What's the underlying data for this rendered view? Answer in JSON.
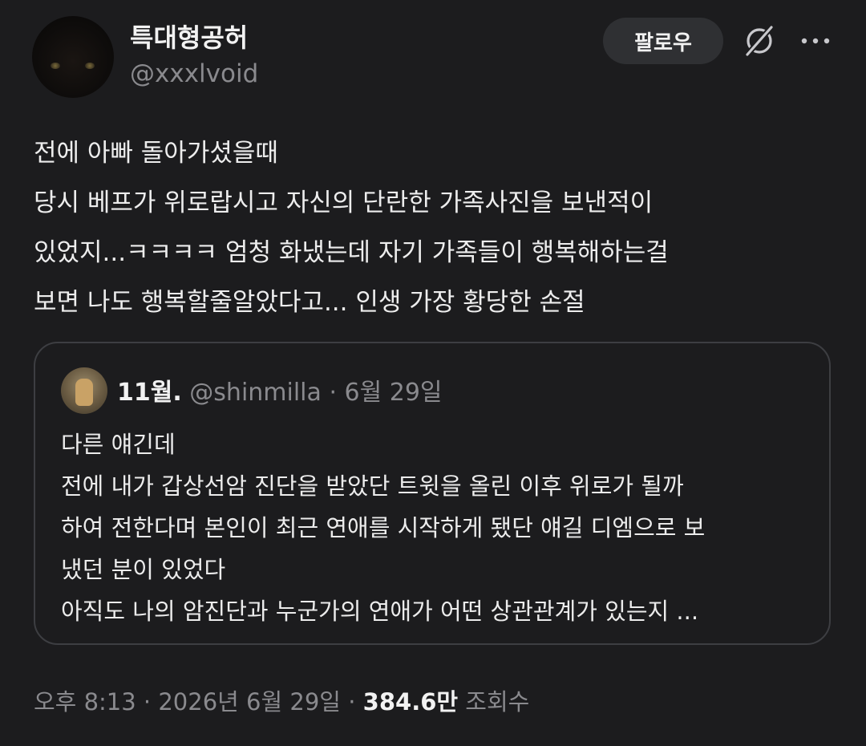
{
  "author": {
    "display_name": "특대형공허",
    "handle": "@xxxlvoid"
  },
  "actions": {
    "follow_label": "팔로우",
    "grok_icon": "grok-icon",
    "more_icon": "more-options-icon"
  },
  "post": {
    "text": "전에 아빠 돌아가셨을때\n당시 베프가 위로랍시고 자신의 단란한 가족사진을 보낸적이\n있었지...ㅋㅋㅋㅋ 엄청 화냈는데 자기 가족들이 행복해하는걸\n보면 나도 행복할줄알았다고... 인생 가장 황당한 손절"
  },
  "quoted": {
    "name": "11월.",
    "handle": "@shinmilla",
    "separator": " · ",
    "date": "6월 29일",
    "text": "다른 얘긴데\n전에 내가 갑상선암 진단을 받았단 트윗을 올린 이후 위로가 될까\n하여 전한다며 본인이 최근 연애를 시작하게 됐단 얘길 디엠으로 보\n냈던 분이 있었다\n아직도 나의 암진단과 누군가의 연애가 어떤 상관관계가 있는지 ..."
  },
  "meta": {
    "time": "오후 8:13",
    "separator": " · ",
    "date": "2026년 6월 29일",
    "views_count": "384.6만",
    "views_label": " 조회수"
  },
  "colors": {
    "background": "#1c1c1e",
    "text": "#ececec",
    "muted": "#8a8a8e",
    "button_bg": "#2f3033",
    "border": "#3d3e42"
  }
}
